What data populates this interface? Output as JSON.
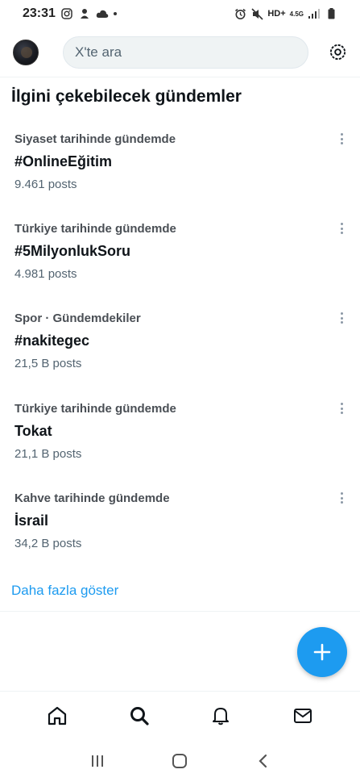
{
  "status_bar": {
    "time": "23:31",
    "network": "HD+",
    "network_sub": "4.5G"
  },
  "header": {
    "search_placeholder": "X'te ara"
  },
  "section": {
    "title": "İlgini çekebilecek gündemler"
  },
  "trends": [
    {
      "context": "Siyaset tarihinde gündemde",
      "name": "#OnlineEğitim",
      "count": "9.461 posts"
    },
    {
      "context": "Türkiye tarihinde gündemde",
      "name": "#5MilyonlukSoru",
      "count": "4.981 posts"
    },
    {
      "context": "Spor · Gündemdekiler",
      "name": "#nakitegec",
      "count": "21,5 B posts"
    },
    {
      "context": "Türkiye tarihinde gündemde",
      "name": "Tokat",
      "count": "21,1 B posts"
    },
    {
      "context": "Kahve tarihinde gündemde",
      "name": "İsrail",
      "count": "34,2 B posts"
    }
  ],
  "show_more": "Daha fazla göster",
  "tabs": [
    "home-icon",
    "search-icon",
    "notifications-bell-icon",
    "messages-envelope-icon"
  ],
  "colors": {
    "accent": "#1d9bf0",
    "text": "#0f1419",
    "secondary": "#536471"
  }
}
